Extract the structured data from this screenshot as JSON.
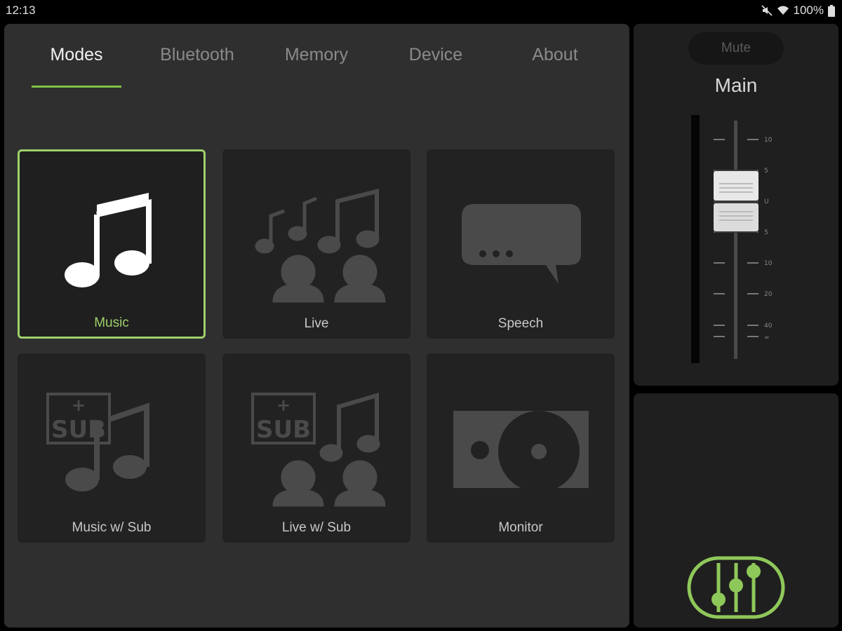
{
  "status_bar": {
    "time": "12:13",
    "battery": "100%"
  },
  "tabs": [
    {
      "label": "Modes",
      "active": true
    },
    {
      "label": "Bluetooth",
      "active": false
    },
    {
      "label": "Memory",
      "active": false
    },
    {
      "label": "Device",
      "active": false
    },
    {
      "label": "About",
      "active": false
    }
  ],
  "modes": [
    {
      "label": "Music",
      "icon": "music-note-icon",
      "selected": true
    },
    {
      "label": "Live",
      "icon": "live-crowd-icon",
      "selected": false
    },
    {
      "label": "Speech",
      "icon": "speech-bubble-icon",
      "selected": false
    },
    {
      "label": "Music w/ Sub",
      "icon": "music-sub-icon",
      "selected": false
    },
    {
      "label": "Live w/ Sub",
      "icon": "live-sub-icon",
      "selected": false
    },
    {
      "label": "Monitor",
      "icon": "monitor-speaker-icon",
      "selected": false
    }
  ],
  "channel": {
    "mute_label": "Mute",
    "name": "Main",
    "scale": [
      "10",
      "5",
      "U",
      "5",
      "10",
      "20",
      "40",
      "∞"
    ]
  },
  "icon_labels": {
    "sub_badge": "SUB",
    "sub_plus": "+"
  },
  "colors": {
    "accent": "#7fc247",
    "panel": "#2f2f2f",
    "tile": "#222222"
  }
}
